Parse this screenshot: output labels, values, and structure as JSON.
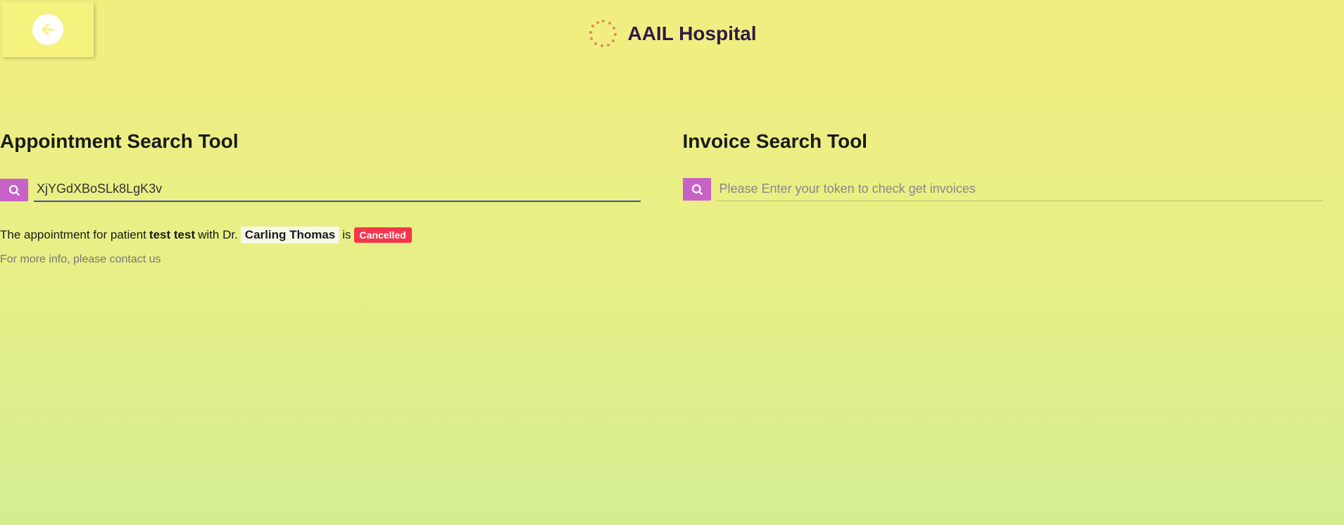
{
  "header": {
    "title": "AAIL Hospital"
  },
  "appointment": {
    "title": "Appointment Search Tool",
    "search_value": "XjYGdXBoSLk8LgK3v",
    "search_placeholder": "",
    "result": {
      "prefix": "The appointment for patient",
      "patient_name": "test test",
      "with_dr": "with Dr.",
      "doctor_name": "Carling Thomas",
      "is_text": "is",
      "status": "Cancelled"
    },
    "info_text": "For more info, please contact us"
  },
  "invoice": {
    "title": "Invoice Search Tool",
    "search_value": "",
    "search_placeholder": "Please Enter your token to check get invoices"
  }
}
